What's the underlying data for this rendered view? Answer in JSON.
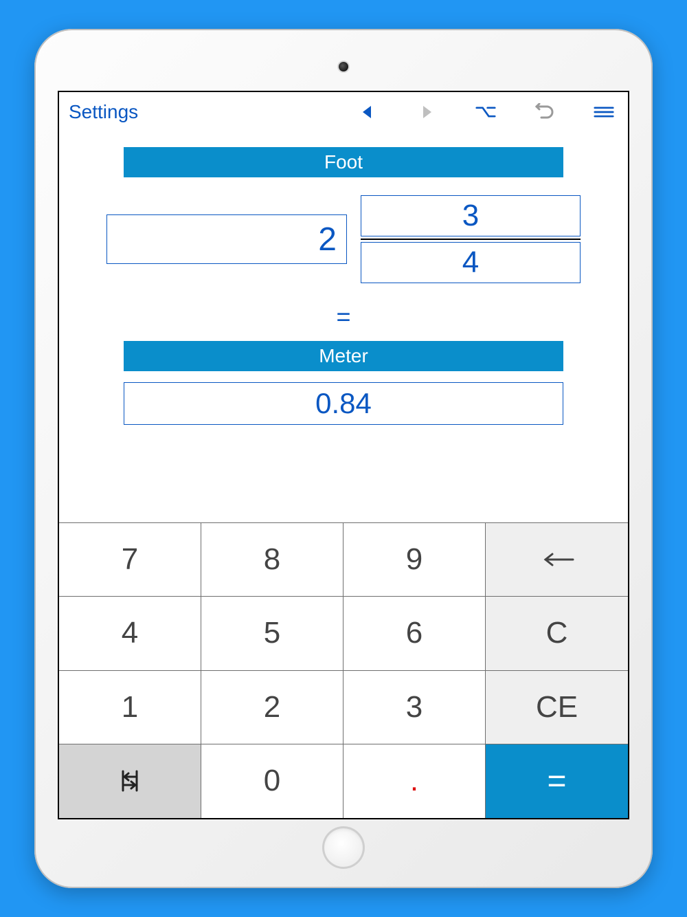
{
  "toolbar": {
    "settings_label": "Settings"
  },
  "conversion": {
    "from_unit": "Foot",
    "to_unit": "Meter",
    "whole": "2",
    "numerator": "3",
    "denominator": "4",
    "equals": "=",
    "result": "0.84"
  },
  "keypad": {
    "k7": "7",
    "k8": "8",
    "k9": "9",
    "k4": "4",
    "k5": "5",
    "k6": "6",
    "clear": "C",
    "k1": "1",
    "k2": "2",
    "k3": "3",
    "clear_entry": "CE",
    "k0": "0",
    "dot": ".",
    "equals": "="
  }
}
